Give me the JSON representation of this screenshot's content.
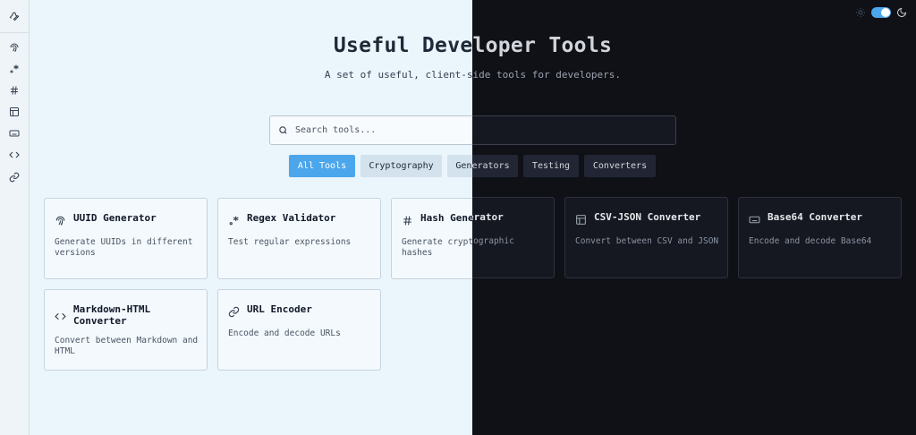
{
  "header": {
    "title": "Useful Developer Tools",
    "subtitle": "A set of useful, client-side tools for developers."
  },
  "search": {
    "placeholder": "Search tools..."
  },
  "filters": [
    {
      "label": "All Tools",
      "active": true
    },
    {
      "label": "Cryptography",
      "active": false
    },
    {
      "label": "Generators",
      "active": false
    },
    {
      "label": "Testing",
      "active": false
    },
    {
      "label": "Converters",
      "active": false
    }
  ],
  "sidebar": {
    "items": [
      {
        "icon": "wrench-icon"
      },
      {
        "icon": "fingerprint-icon"
      },
      {
        "icon": "regex-icon"
      },
      {
        "icon": "hash-icon"
      },
      {
        "icon": "table-icon"
      },
      {
        "icon": "keyboard-icon"
      },
      {
        "icon": "code-icon"
      },
      {
        "icon": "link-icon"
      }
    ]
  },
  "tools": [
    {
      "title": "UUID Generator",
      "desc": "Generate UUIDs in different versions",
      "icon": "fingerprint-icon"
    },
    {
      "title": "Regex Validator",
      "desc": "Test regular expressions",
      "icon": "regex-icon"
    },
    {
      "title": "Hash Generator",
      "desc": "Generate cryptographic hashes",
      "icon": "hash-icon"
    },
    {
      "title": "CSV-JSON Converter",
      "desc": "Convert between CSV and JSON",
      "icon": "table-icon"
    },
    {
      "title": "Base64 Converter",
      "desc": "Encode and decode Base64",
      "icon": "keyboard-icon"
    },
    {
      "title": "Markdown-HTML Converter",
      "desc": "Convert between Markdown and HTML",
      "icon": "code-icon"
    },
    {
      "title": "URL Encoder",
      "desc": "Encode and decode URLs",
      "icon": "link-icon"
    }
  ],
  "theme": {
    "icon_light": "sun-icon",
    "icon_dark": "moon-icon",
    "mode": "dark"
  },
  "colors": {
    "accent": "#4ca6ec",
    "light_bg": "#eaf5fc",
    "dark_bg": "#0f1117"
  }
}
